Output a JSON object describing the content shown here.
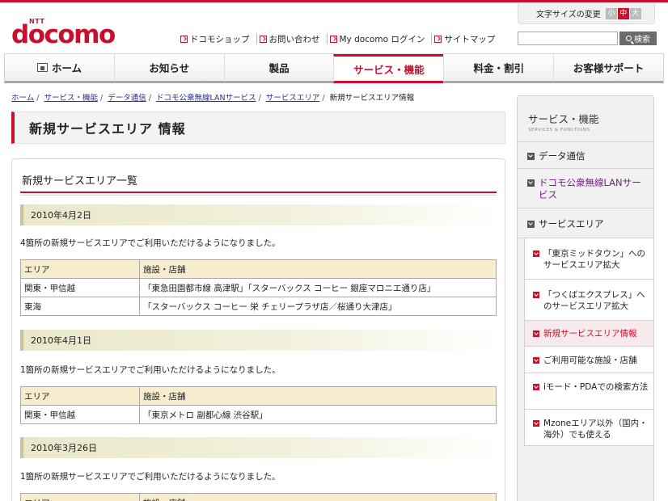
{
  "brand": {
    "ntt": "NTT",
    "name": "docomo",
    "color": "#c8102e"
  },
  "utility_links": [
    {
      "label": "ドコモショップ"
    },
    {
      "label": "お問い合わせ"
    },
    {
      "label": "My docomo ログイン"
    },
    {
      "label": "サイトマップ"
    }
  ],
  "font_size": {
    "label": "文字サイズの変更",
    "small": "小",
    "medium": "中",
    "large": "大",
    "selected": "中"
  },
  "search": {
    "placeholder": "",
    "button": "検索"
  },
  "global_nav": [
    {
      "label": "ホーム",
      "icon": "home-icon"
    },
    {
      "label": "お知らせ"
    },
    {
      "label": "製品"
    },
    {
      "label": "サービス・機能",
      "active": true
    },
    {
      "label": "料金・割引"
    },
    {
      "label": "お客様サポート"
    }
  ],
  "breadcrumb": {
    "items": [
      "ホーム",
      "サービス・機能",
      "データ通信",
      "ドコモ公衆無線LANサービス",
      "サービスエリア"
    ],
    "current": "新規サービスエリア情報",
    "separator": "/"
  },
  "page_title": "新規サービスエリア 情報",
  "list_heading": "新規サービスエリア一覧",
  "table_header": {
    "area": "エリア",
    "facility": "施設・店舗"
  },
  "entries": [
    {
      "date": "2010年4月2日",
      "notice": "4箇所の新規サービスエリアでご利用いただけるようになりました。",
      "rows": [
        {
          "area": "関東・甲信越",
          "facility": "「東急田園都市線 高津駅」「スターバックス コーヒー 銀座マロニエ通り店」"
        },
        {
          "area": "東海",
          "facility": "「スターバックス コーヒー 栄 チェリープラザ店／桜通り大津店」"
        }
      ]
    },
    {
      "date": "2010年4月1日",
      "notice": "1箇所の新規サービスエリアでご利用いただけるようになりました。",
      "rows": [
        {
          "area": "関東・甲信越",
          "facility": "「東京メトロ 副都心線 渋谷駅」"
        }
      ]
    },
    {
      "date": "2010年3月26日",
      "notice": "1箇所の新規サービスエリアでご利用いただけるようになりました。",
      "rows": []
    }
  ],
  "sidebar": {
    "title": "サービス・機能",
    "subtitle": "SERVICES & FUNCTIONS",
    "items": [
      {
        "label": "データ通信"
      },
      {
        "label": "ドコモ公衆無線LANサービス"
      },
      {
        "label": "サービスエリア"
      }
    ],
    "sub_items": [
      {
        "label": "「東京ミッドタウン」へのサービスエリア拡大"
      },
      {
        "label": "「つくばエクスプレス」へのサービスエリア拡大"
      },
      {
        "label": "新規サービスエリア情報",
        "current": true
      },
      {
        "label": "ご利用可能な施設・店舗"
      },
      {
        "label": "iモード・PDAでの検索方法"
      },
      {
        "label": "Mzoneエリア以外（国内・海外）でも使える"
      }
    ]
  }
}
